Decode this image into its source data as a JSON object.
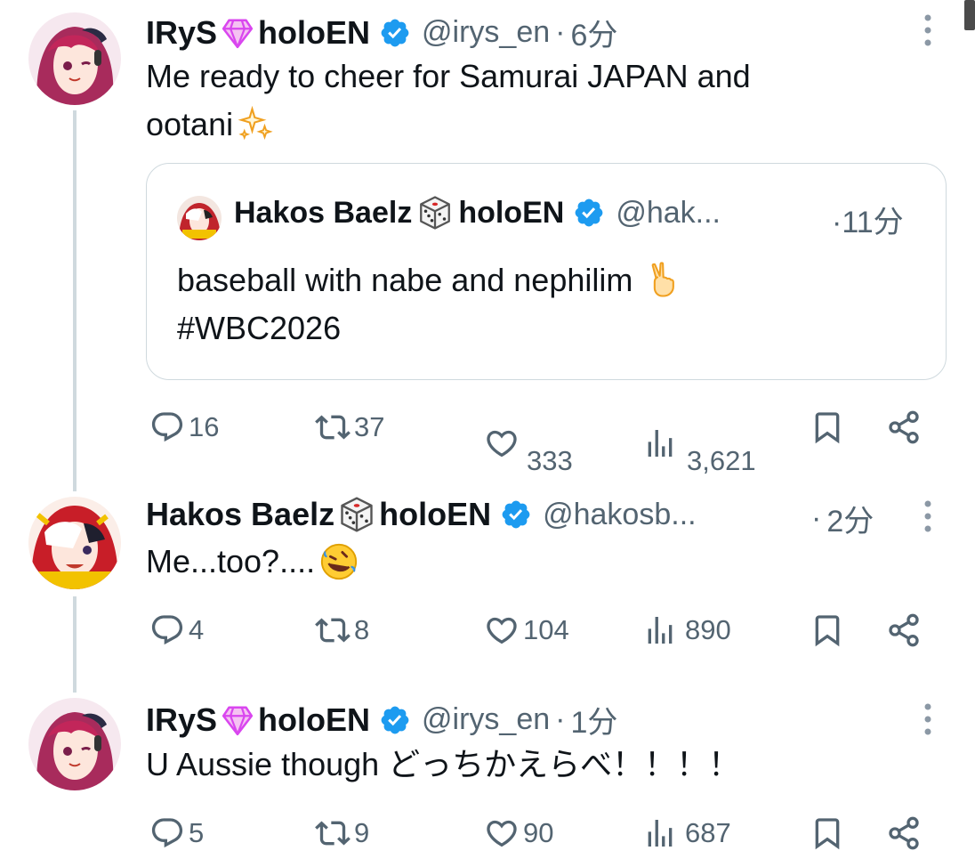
{
  "colors": {
    "accent": "#1d9bf0",
    "verified": "#1d9bf0",
    "secondary_text": "#536471",
    "gem": "#d946ef"
  },
  "tweets": [
    {
      "name_part1": "IRyS",
      "name_emoji": "gem-icon",
      "name_part2": "holoEN",
      "handle": "@irys_en",
      "dot": "·",
      "time": "6分",
      "text_line1": "Me ready to cheer for Samurai JAPAN and",
      "text_line2": "ootani",
      "quote": {
        "name_part1": "Hakos Baelz",
        "name_emoji": "dice-icon",
        "name_part2": "holoEN",
        "handle": "@hak...",
        "dot": "·",
        "time": "11分",
        "text_line1": "baseball with nabe and nephilim",
        "text_line2": "#WBC2026"
      },
      "actions": {
        "replies": "16",
        "retweets": "37",
        "likes": "333",
        "views": "3,621"
      }
    },
    {
      "name_part1": "Hakos Baelz",
      "name_emoji": "dice-icon",
      "name_part2": "holoEN",
      "handle": "@hakosb...",
      "dot": "·",
      "time": "2分",
      "text_line1": "Me...too?....",
      "actions": {
        "replies": "4",
        "retweets": "8",
        "likes": "104",
        "views": "890"
      }
    },
    {
      "name_part1": "IRyS",
      "name_emoji": "gem-icon",
      "name_part2": "holoEN",
      "handle": "@irys_en",
      "dot": "·",
      "time": "1分",
      "text_line1": "U Aussie though どっちかえらべ！！！！",
      "actions": {
        "replies": "5",
        "retweets": "9",
        "likes": "90",
        "views": "687"
      }
    }
  ]
}
